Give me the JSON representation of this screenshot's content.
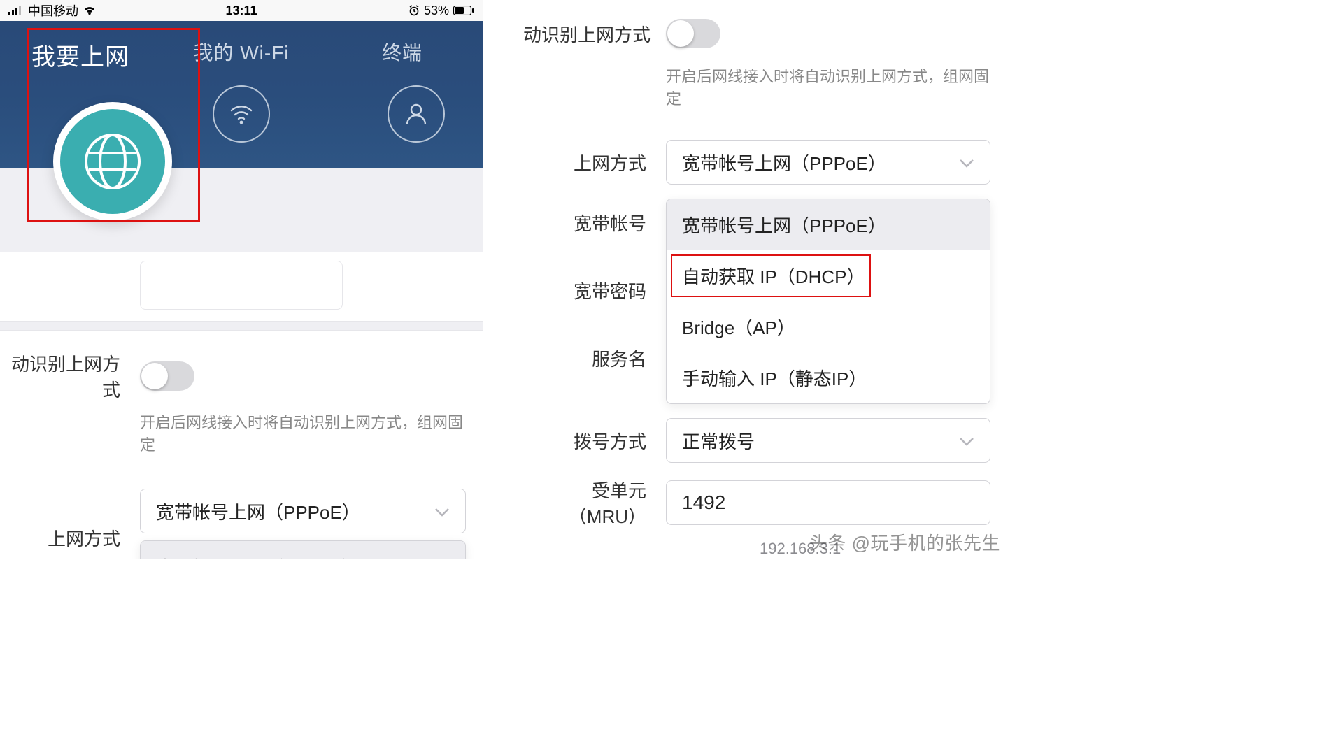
{
  "statusbar": {
    "carrier": "中国移动",
    "time": "13:11",
    "battery_pct": "53%"
  },
  "header": {
    "tabs": [
      {
        "label": "我要上网"
      },
      {
        "label": "我的 Wi-Fi"
      },
      {
        "label": "终端"
      }
    ]
  },
  "settings": {
    "auto_detect_label": "动识别上网方式",
    "auto_detect_hint": "开启后网线接入时将自动识别上网方式，组网固定",
    "conn_mode_label": "上网方式",
    "conn_mode_value": "宽带帐号上网（PPPoE）",
    "account_label": "宽带帐号",
    "password_label": "宽带密码",
    "service_label": "服务名",
    "dial_mode_label": "拨号方式",
    "dial_mode_value": "正常拨号",
    "mru_label": "受单元（MRU）",
    "mru_value": "1492",
    "options": [
      "宽带帐号上网（PPPoE）",
      "自动获取 IP（DHCP）",
      "Bridge（AP）",
      "手动输入 IP（静态IP）"
    ]
  },
  "footer_ip": "192.168.3.1",
  "watermark": "头条 @玩手机的张先生"
}
